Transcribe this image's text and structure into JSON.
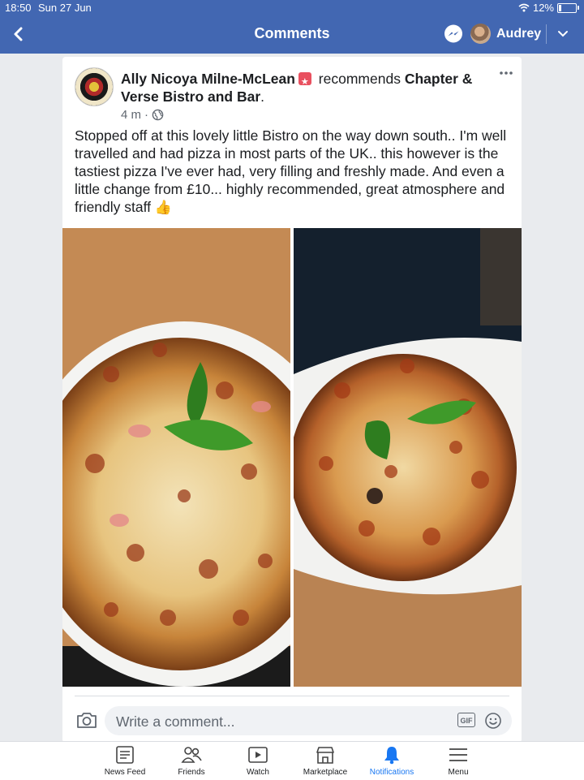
{
  "status_bar": {
    "time": "18:50",
    "date": "Sun 27 Jun",
    "battery": "12%"
  },
  "header": {
    "title": "Comments",
    "user_name": "Audrey"
  },
  "post": {
    "author": "Ally Nicoya Milne-McLean",
    "action": "recommends",
    "page_name": "Chapter & Verse Bistro and Bar",
    "period": ".",
    "time": "4 m",
    "dot": "·",
    "text": "Stopped off at this lovely little Bistro on the way down south.. I'm well travelled and had pizza in most parts of the UK..  this however is the tastiest pizza I've ever had, very filling and freshly made. And even a little change from £10... highly recommended,  great atmosphere and friendly staff",
    "emoji": "👍",
    "photos": [
      "pizza-photo-1",
      "pizza-photo-2"
    ]
  },
  "comment_input": {
    "placeholder": "Write a comment...",
    "gif_label": "GIF"
  },
  "nav": [
    {
      "label": "News Feed",
      "icon": "news-feed-icon"
    },
    {
      "label": "Friends",
      "icon": "friends-icon"
    },
    {
      "label": "Watch",
      "icon": "watch-icon"
    },
    {
      "label": "Marketplace",
      "icon": "marketplace-icon"
    },
    {
      "label": "Notifications",
      "icon": "notifications-icon",
      "active": true
    },
    {
      "label": "Menu",
      "icon": "menu-icon"
    }
  ],
  "colors": {
    "brand": "#4267b2",
    "active": "#1877f2",
    "badge": "#e9505f"
  }
}
